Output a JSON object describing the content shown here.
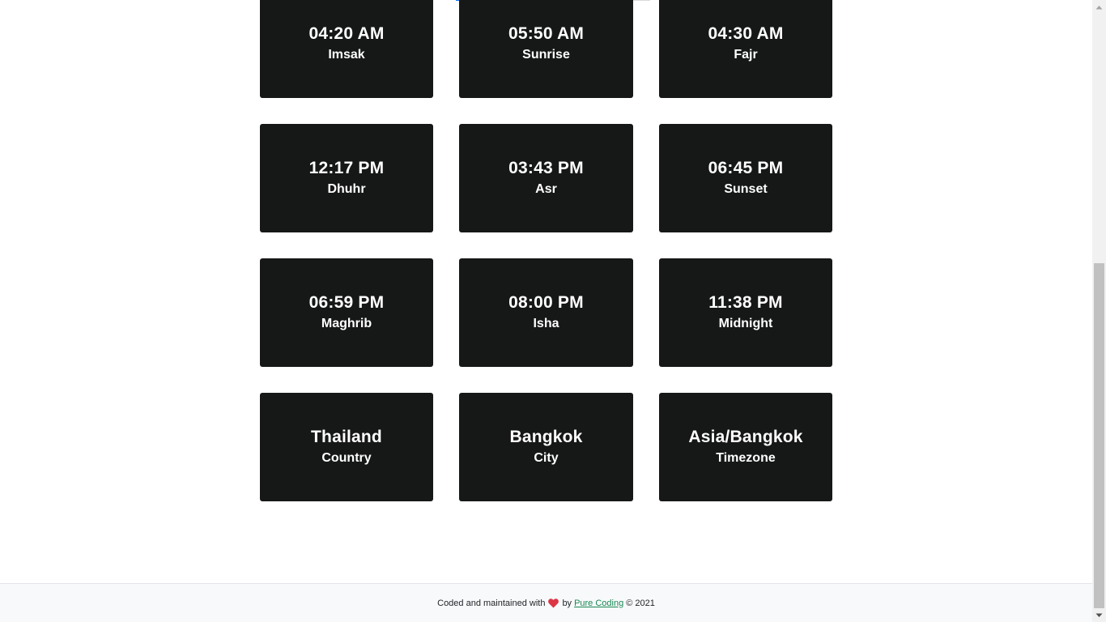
{
  "cards": [
    {
      "value": "04:20 AM",
      "label": "Imsak"
    },
    {
      "value": "05:50 AM",
      "label": "Sunrise"
    },
    {
      "value": "04:30 AM",
      "label": "Fajr"
    },
    {
      "value": "12:17 PM",
      "label": "Dhuhr"
    },
    {
      "value": "03:43 PM",
      "label": "Asr"
    },
    {
      "value": "06:45 PM",
      "label": "Sunset"
    },
    {
      "value": "06:59 PM",
      "label": "Maghrib"
    },
    {
      "value": "08:00 PM",
      "label": "Isha"
    },
    {
      "value": "11:38 PM",
      "label": "Midnight"
    },
    {
      "value": "Thailand",
      "label": "Country"
    },
    {
      "value": "Bangkok",
      "label": "City"
    },
    {
      "value": "Asia/Bangkok",
      "label": "Timezone"
    }
  ],
  "progress_bar": {
    "fraction": 0.2,
    "fill_color": "#0d6efd",
    "track_color": "#d9d9d9"
  },
  "footer": {
    "text_before": "Coded and maintained with",
    "heart_icon": "heart-icon",
    "text_by": "by",
    "link_text": "Pure Coding",
    "text_after": "© 2021"
  },
  "scrollbar": {
    "position_fraction": 1.0,
    "visible_fraction": 0.58
  },
  "colors": {
    "card_bg": "#161717",
    "card_text": "#ffffff",
    "heart": "#dc3545",
    "link": "#198754",
    "footer_bg": "#f8f9fa"
  }
}
